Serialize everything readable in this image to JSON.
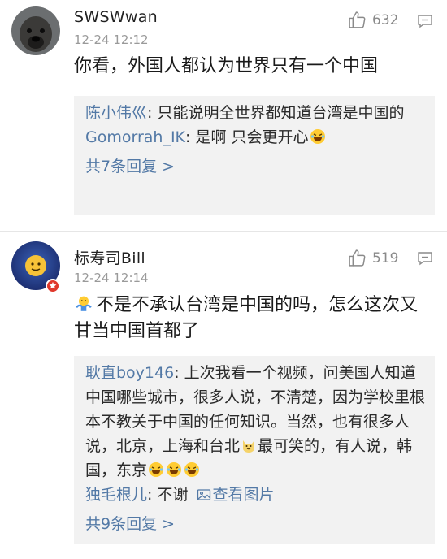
{
  "comments": [
    {
      "username": "SWSWwan",
      "time": "12-24 12:12",
      "likes": "632",
      "content": "你看，外国人都认为世界只有一个中国",
      "replies": [
        {
          "user": "陈小伟巛",
          "text": "只能说明全世界都知道台湾是中国的"
        },
        {
          "user": "Gomorrah_IK",
          "text": "是啊 只会更开心"
        }
      ],
      "reply_count": "共7条回复 >"
    },
    {
      "username": "标寿司Bill",
      "time": "12-24 12:14",
      "likes": "519",
      "content": "不是不承认台湾是中国的吗，怎么这次又甘当中国首都了",
      "replies": [
        {
          "user": "耿直boy146",
          "text_a": "上次我看一个视频，问美国人知道中国哪些城市，很多人说，不清楚，因为学校里根本不教关于中国的任何知识。当然，也有很多人说，北京，上海和台北",
          "text_b": "最可笑的，有人说，韩国，东京"
        },
        {
          "user": "独毛根儿",
          "text": "不谢",
          "link": "查看图片"
        }
      ],
      "reply_count": "共9条回复 >"
    }
  ],
  "colors": {
    "reply_user": "#5379a6",
    "reply_bg": "#f2f2f2",
    "timestamp": "#9a9a9a"
  },
  "icons": [
    "avatar-dog",
    "avatar-emoji",
    "thumbs-up-icon",
    "comment-icon",
    "laughing-emoji",
    "shrug-emoji",
    "cat-emoji",
    "image-icon"
  ]
}
